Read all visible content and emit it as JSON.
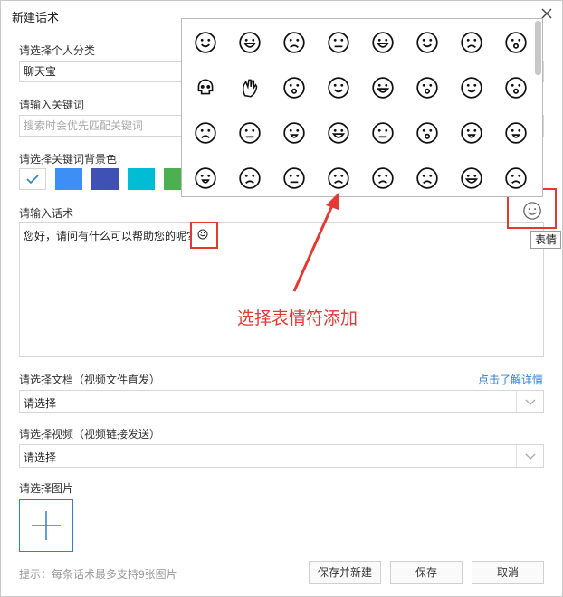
{
  "window": {
    "title": "新建话术"
  },
  "category": {
    "label": "请选择个人分类",
    "value": "聊天宝"
  },
  "keyword": {
    "label": "请输入关键词",
    "placeholder": "搜索时会优先匹配关键词"
  },
  "bg_color": {
    "label": "请选择关键词背景色",
    "swatches": [
      "#ffffff",
      "#3d8ef5",
      "#3f51b5",
      "#00bcd4",
      "#4caf50"
    ],
    "selected_index": 0
  },
  "script": {
    "label": "请输入话术",
    "text": "您好，请问有什么可以帮助您的呢?"
  },
  "emoji_button": {
    "tooltip": "表情"
  },
  "document": {
    "label": "请选择文档（视频文件直发）",
    "value": "请选择",
    "link": "点击了解详情"
  },
  "video": {
    "label": "请选择视频（视频链接发送）",
    "value": "请选择"
  },
  "images": {
    "label": "请选择图片"
  },
  "footer": {
    "hint": "提示：每条话术最多支持9张图片",
    "buttons": {
      "save_new": "保存并新建",
      "save": "保存",
      "cancel": "取消"
    }
  },
  "annotation": {
    "text": "选择表情符添加",
    "color": "#e53935"
  },
  "emoji_panel": {
    "rows": [
      [
        "grinning-face",
        "heart-eyes-face",
        "crying-face",
        "angry-face",
        "grimacing-face",
        "smiling-face",
        "sad-face",
        "dizzy-face"
      ],
      [
        "skull",
        "waving-hand",
        "flushed-face",
        "smiling-face",
        "mask-face",
        "surprised-face",
        "laughing-face",
        "screaming-face"
      ],
      [
        "pensive-face",
        "unamused-face",
        "winking-face",
        "relieved-face",
        "expressionless-face",
        "confounded-face",
        "kissing-face",
        "tongue-face"
      ],
      [
        "squinting-tongue-face",
        "disappointed-face",
        "angry-face",
        "crying-face",
        "persevering-face",
        "sweat-face",
        "glasses-face",
        "anxious-face"
      ]
    ]
  }
}
